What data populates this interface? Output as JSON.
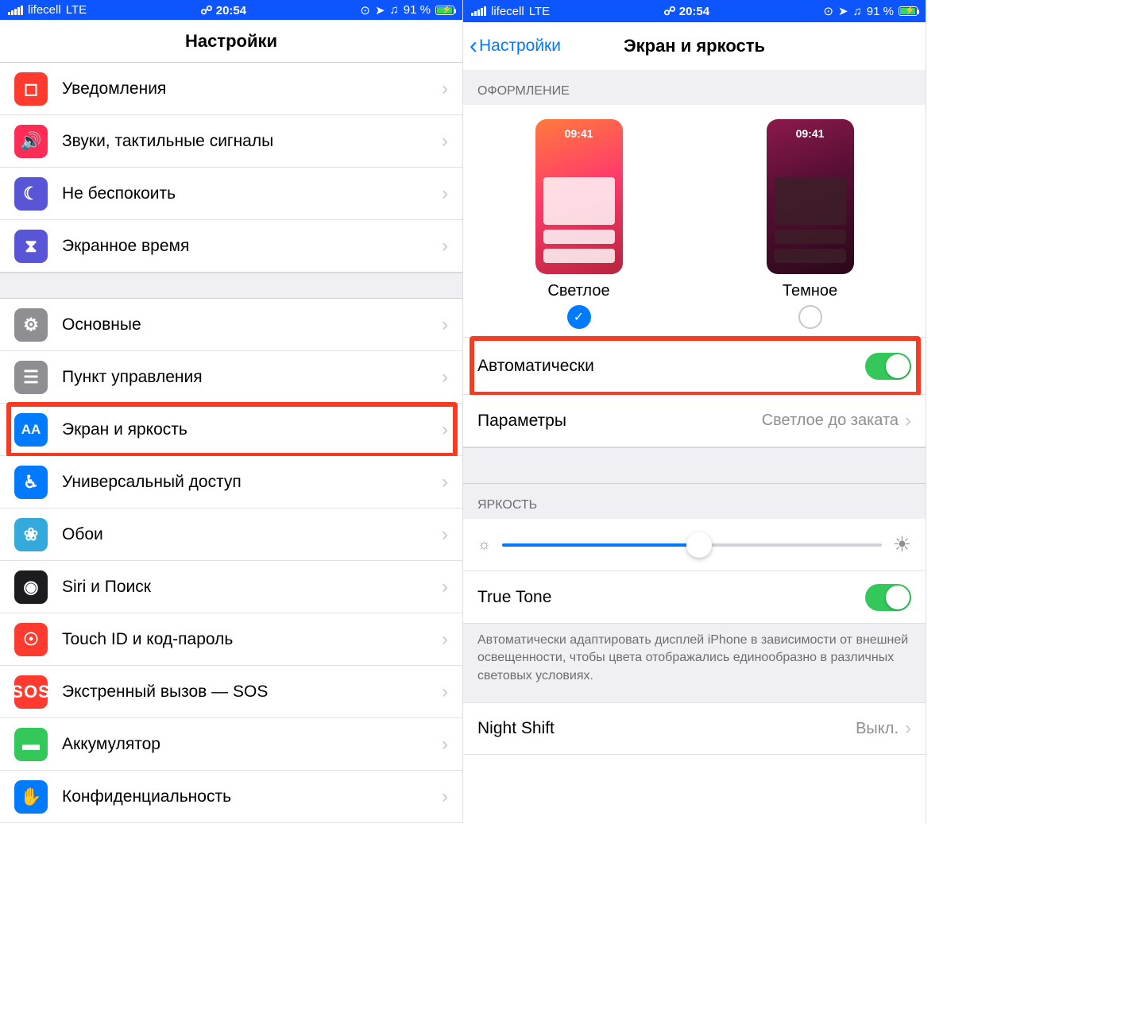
{
  "statusbar": {
    "carrier": "lifecell",
    "network": "LTE",
    "time": "20:54",
    "battery_pct": "91 %"
  },
  "left": {
    "title": "Настройки",
    "rows_a": [
      {
        "label": "Уведомления",
        "icon_color": "ic-red",
        "glyph": "◻︎"
      },
      {
        "label": "Звуки, тактильные сигналы",
        "icon_color": "ic-pink",
        "glyph": "🔊"
      },
      {
        "label": "Не беспокоить",
        "icon_color": "ic-purple",
        "glyph": "☾"
      },
      {
        "label": "Экранное время",
        "icon_color": "ic-purple",
        "glyph": "⧗"
      }
    ],
    "rows_b": [
      {
        "label": "Основные",
        "icon_color": "ic-gray",
        "glyph": "⚙"
      },
      {
        "label": "Пункт управления",
        "icon_color": "ic-gray",
        "glyph": "☰"
      },
      {
        "label": "Экран и яркость",
        "icon_color": "ic-blue",
        "glyph": "AA",
        "highlighted": true
      },
      {
        "label": "Универсальный доступ",
        "icon_color": "ic-blue",
        "glyph": "♿︎"
      },
      {
        "label": "Обои",
        "icon_color": "ic-teal",
        "glyph": "❀"
      },
      {
        "label": "Siri и Поиск",
        "icon_color": "ic-black",
        "glyph": "◉"
      },
      {
        "label": "Touch ID и код-пароль",
        "icon_color": "ic-red",
        "glyph": "☉"
      },
      {
        "label": "Экстренный вызов — SOS",
        "icon_color": "ic-sos",
        "glyph": "SOS"
      },
      {
        "label": "Аккумулятор",
        "icon_color": "ic-green",
        "glyph": "▬"
      },
      {
        "label": "Конфиденциальность",
        "icon_color": "ic-blue",
        "glyph": "✋"
      }
    ]
  },
  "right": {
    "back_label": "Настройки",
    "title": "Экран и яркость",
    "appearance_header": "ОФОРМЛЕНИЕ",
    "light_label": "Светлое",
    "dark_label": "Темное",
    "thumb_time": "09:41",
    "auto_label": "Автоматически",
    "params_label": "Параметры",
    "params_value": "Светлое до заката",
    "brightness_header": "ЯРКОСТЬ",
    "truetone_label": "True Tone",
    "truetone_desc": "Автоматически адаптировать дисплей iPhone в зависимости от внешней освещенности, чтобы цвета отображались единообразно в различных световых условиях.",
    "nightshift_label": "Night Shift",
    "nightshift_value": "Выкл."
  }
}
